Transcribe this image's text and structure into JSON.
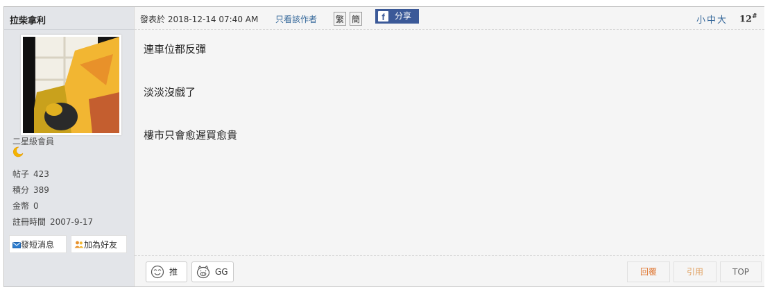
{
  "user": {
    "name": "拉柴拿利",
    "rank": "二星級會員",
    "stats": [
      {
        "label": "帖子",
        "value": "423"
      },
      {
        "label": "積分",
        "value": "389"
      },
      {
        "label": "金幣",
        "value": "0"
      },
      {
        "label": "註冊時間",
        "value": "2007-9-17"
      }
    ],
    "actions": {
      "message": "發短消息",
      "add_friend": "加為好友"
    }
  },
  "post": {
    "time": "發表於 2018-12-14 07:40 AM",
    "only_author": "只看該作者",
    "traditional": "繁",
    "simplified": "簡",
    "share": "分享",
    "font_sizes": "小中大",
    "floor": "12",
    "floor_mark": "#",
    "lines": [
      "連車位都反彈",
      "淡淡沒戲了",
      "樓市只會愈遲買愈貴"
    ]
  },
  "footer": {
    "like": "推",
    "gg": "GG",
    "reply": "回覆",
    "quote": "引用",
    "top": "TOP"
  },
  "colors": {
    "link": "#336699",
    "share_bg": "#3b5998",
    "reply_text": "#e07b39"
  }
}
